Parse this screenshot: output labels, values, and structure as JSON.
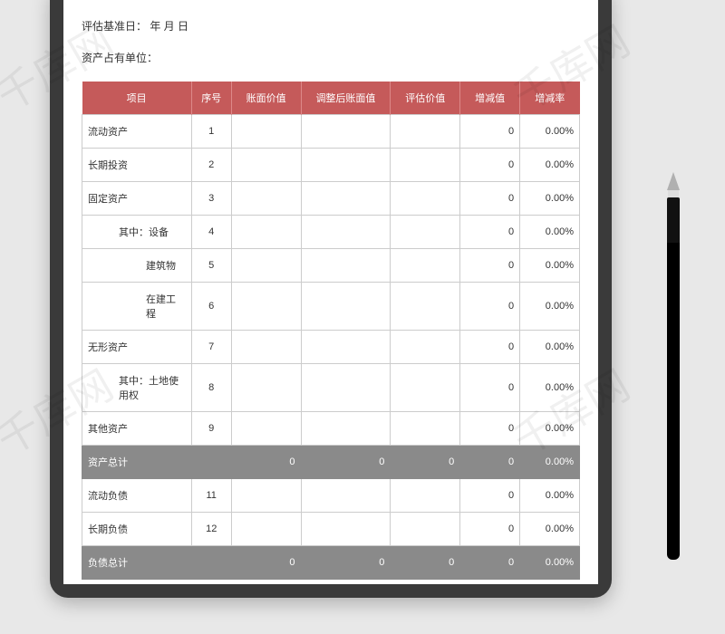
{
  "meta": {
    "baseline_label": "评估基准日：  年  月  日",
    "unit_label": "资产占有单位："
  },
  "columns": {
    "item": "项目",
    "seq": "序号",
    "book": "账面价值",
    "adj": "调整后账面值",
    "eval": "评估价值",
    "diff": "增减值",
    "rate": "增减率"
  },
  "rows": [
    {
      "type": "row",
      "item": "流动资产",
      "indent": 0,
      "seq": "1",
      "book": "",
      "adj": "",
      "eval": "",
      "diff": "0",
      "rate": "0.00%"
    },
    {
      "type": "row",
      "item": "长期投资",
      "indent": 0,
      "seq": "2",
      "book": "",
      "adj": "",
      "eval": "",
      "diff": "0",
      "rate": "0.00%"
    },
    {
      "type": "row",
      "item": "固定资产",
      "indent": 0,
      "seq": "3",
      "book": "",
      "adj": "",
      "eval": "",
      "diff": "0",
      "rate": "0.00%"
    },
    {
      "type": "row",
      "item": "其中：设备",
      "indent": 1,
      "seq": "4",
      "book": "",
      "adj": "",
      "eval": "",
      "diff": "0",
      "rate": "0.00%"
    },
    {
      "type": "row",
      "item": "建筑物",
      "indent": 2,
      "seq": "5",
      "book": "",
      "adj": "",
      "eval": "",
      "diff": "0",
      "rate": "0.00%"
    },
    {
      "type": "row",
      "item": "在建工程",
      "indent": 2,
      "seq": "6",
      "book": "",
      "adj": "",
      "eval": "",
      "diff": "0",
      "rate": "0.00%"
    },
    {
      "type": "row",
      "item": "无形资产",
      "indent": 0,
      "seq": "7",
      "book": "",
      "adj": "",
      "eval": "",
      "diff": "0",
      "rate": "0.00%"
    },
    {
      "type": "row",
      "item": "其中：土地使用权",
      "indent": 1,
      "seq": "8",
      "book": "",
      "adj": "",
      "eval": "",
      "diff": "0",
      "rate": "0.00%"
    },
    {
      "type": "row",
      "item": "其他资产",
      "indent": 0,
      "seq": "9",
      "book": "",
      "adj": "",
      "eval": "",
      "diff": "0",
      "rate": "0.00%"
    },
    {
      "type": "total",
      "item": "资产总计",
      "seq": "",
      "book": "0",
      "adj": "0",
      "eval": "0",
      "diff": "0",
      "rate": "0.00%"
    },
    {
      "type": "row",
      "item": "流动负债",
      "indent": 0,
      "seq": "11",
      "book": "",
      "adj": "",
      "eval": "",
      "diff": "0",
      "rate": "0.00%"
    },
    {
      "type": "row",
      "item": "长期负债",
      "indent": 0,
      "seq": "12",
      "book": "",
      "adj": "",
      "eval": "",
      "diff": "0",
      "rate": "0.00%"
    },
    {
      "type": "total",
      "item": "负债总计",
      "seq": "",
      "book": "0",
      "adj": "0",
      "eval": "0",
      "diff": "0",
      "rate": "0.00%"
    }
  ],
  "watermark": "千库网"
}
